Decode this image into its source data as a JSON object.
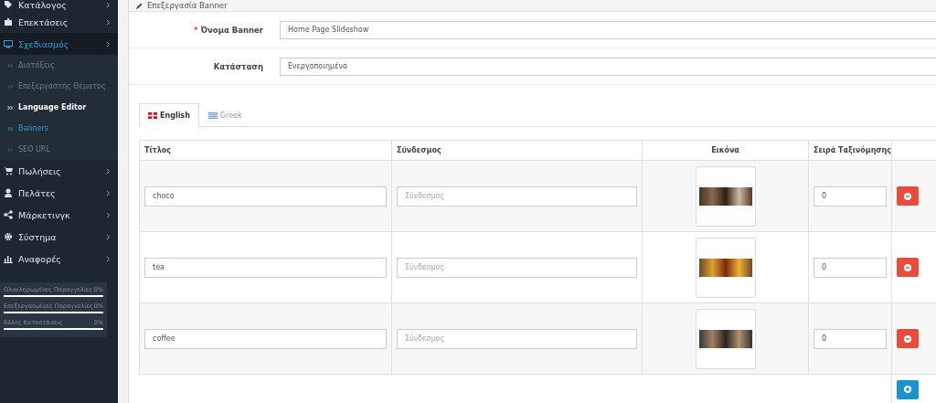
{
  "sidebar": {
    "items": [
      {
        "label": "Κατάλογος",
        "selected": false
      },
      {
        "label": "Επεκτάσεις",
        "selected": false
      },
      {
        "label": "Σχεδιασμός",
        "selected": true,
        "children": [
          {
            "label": "Διατάξεις",
            "selected": false,
            "hovered": false
          },
          {
            "label": "Επεξεργαστής Θέματος",
            "selected": false,
            "hovered": false
          },
          {
            "label": "Language Editor",
            "selected": false,
            "hovered": true
          },
          {
            "label": "Banners",
            "selected": true,
            "hovered": false
          },
          {
            "label": "SEO URL",
            "selected": false,
            "hovered": false
          }
        ]
      },
      {
        "label": "Πωλήσεις",
        "selected": false
      },
      {
        "label": "Πελάτες",
        "selected": false
      },
      {
        "label": "Μάρκετινγκ",
        "selected": false
      },
      {
        "label": "Σύστημα",
        "selected": false
      },
      {
        "label": "Αναφορές",
        "selected": false
      }
    ],
    "stats": [
      {
        "label": "Ολοκληρωμένες Παραγγελίες",
        "reading": "0%",
        "level": 0
      },
      {
        "label": "Επεξεργαομένες Παραγγελίες",
        "reading": "0%",
        "level": 0
      },
      {
        "label": "Άλλες Καταστάσεις",
        "reading": "0%",
        "level": 0
      }
    ]
  },
  "panel": {
    "title": "Επεξεργασία Banner",
    "fields": [
      {
        "label": "Όνομα Banner",
        "required_mark": "*",
        "value": "Home Page Slideshow"
      },
      {
        "label": "Κατάσταση",
        "value": "Ενεργοποιημένο"
      }
    ],
    "tabs": [
      {
        "label": "English",
        "selected": true
      },
      {
        "label": "Greek",
        "selected": false
      }
    ],
    "table": {
      "columns": [
        "Τίτλος",
        "Σύνδεσμος",
        "Εικόνα",
        "Σειρά Ταξινόμησης"
      ],
      "rows": [
        {
          "title": "choco",
          "link_placeholder": "Σύνδεσμος",
          "sort_order": "0"
        },
        {
          "title": "tea",
          "link_placeholder": "Σύνδεσμος",
          "sort_order": "0"
        },
        {
          "title": "coffee",
          "link_placeholder": "Σύνδεσμος",
          "sort_order": "0"
        }
      ]
    }
  }
}
